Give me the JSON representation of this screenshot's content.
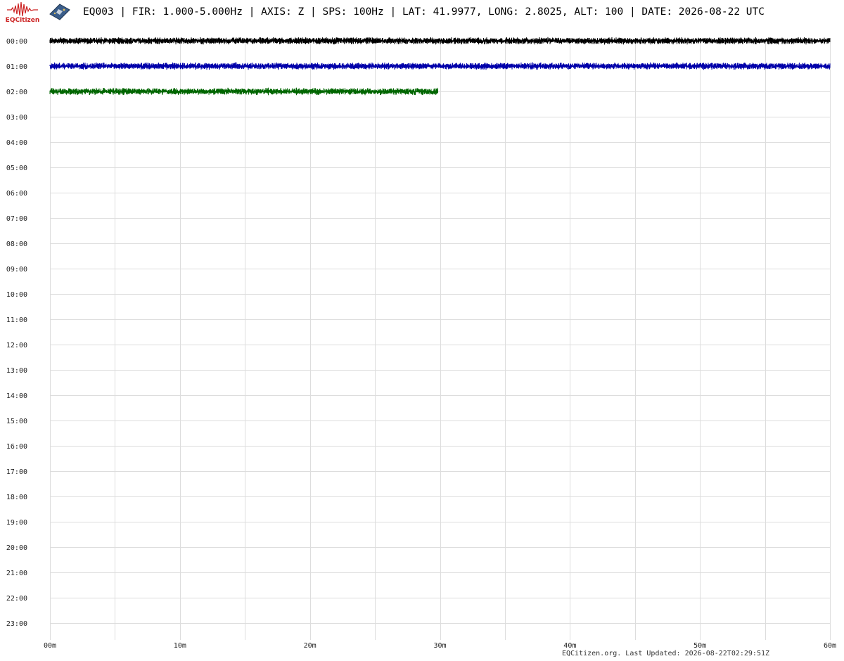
{
  "header": {
    "logo_text": "EQCitizen",
    "logo_icon": "seismic-wave-icon",
    "device_icon": "sensor-board-icon",
    "title": "EQ003 | FIR: 1.000-5.000Hz | AXIS: Z | SPS: 100Hz | LAT: 41.9977, LONG: 2.8025, ALT: 100 | DATE: 2026-08-22 UTC"
  },
  "footer": {
    "text": "EQCitizen.org. Last Updated: 2026-08-22T02:29:51Z"
  },
  "chart_data": {
    "type": "line",
    "title": "",
    "xlabel": "",
    "ylabel": "",
    "x_ticks": [
      "00m",
      "10m",
      "20m",
      "30m",
      "40m",
      "50m",
      "60m"
    ],
    "x_range": [
      0,
      60
    ],
    "rows": [
      "00:00",
      "01:00",
      "02:00",
      "03:00",
      "04:00",
      "05:00",
      "06:00",
      "07:00",
      "08:00",
      "09:00",
      "10:00",
      "11:00",
      "12:00",
      "13:00",
      "14:00",
      "15:00",
      "16:00",
      "17:00",
      "18:00",
      "19:00",
      "20:00",
      "21:00",
      "22:00",
      "23:00"
    ],
    "grid": true,
    "grid_color": "#dddddd",
    "traces": [
      {
        "row": "00:00",
        "start_min": 0,
        "end_min": 60,
        "color": "#000000"
      },
      {
        "row": "01:00",
        "start_min": 0,
        "end_min": 60,
        "color": "#0000aa"
      },
      {
        "row": "02:00",
        "start_min": 0,
        "end_min": 29.85,
        "color": "#006600"
      }
    ]
  }
}
